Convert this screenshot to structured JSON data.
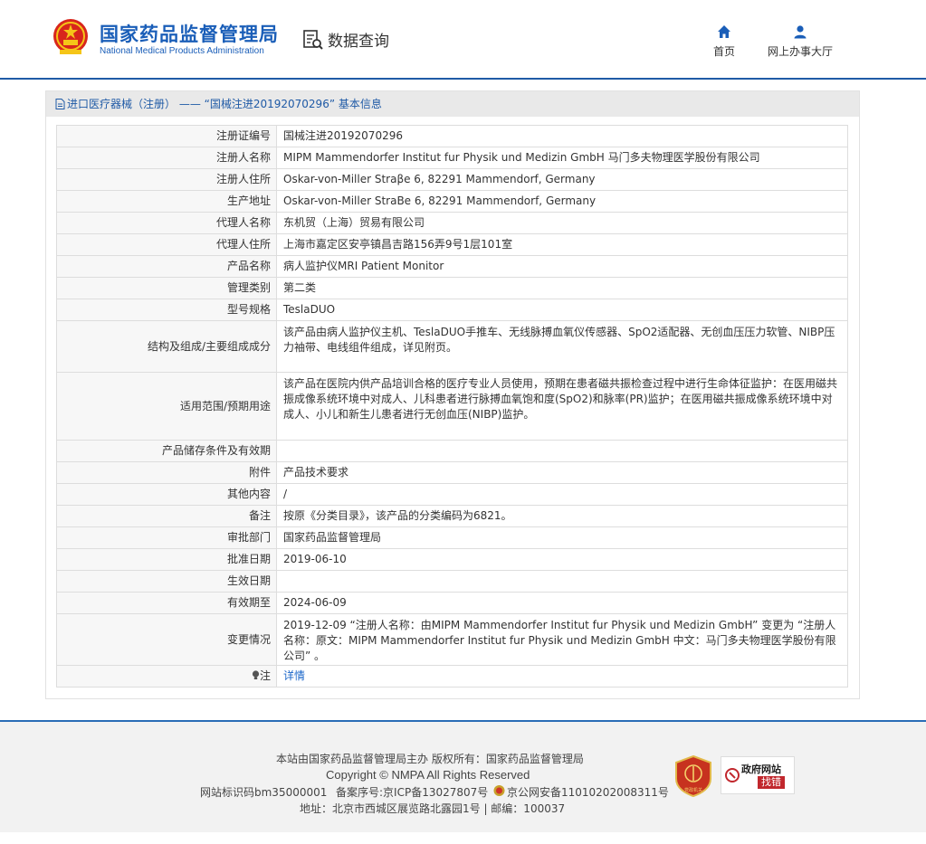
{
  "header": {
    "logo_cn": "国家药品监督管理局",
    "logo_en": "National Medical Products Administration",
    "query_label": "数据查询",
    "nav": [
      {
        "label": "首页",
        "icon": "home-icon"
      },
      {
        "label": "网上办事大厅",
        "icon": "user-icon"
      }
    ],
    "brand_color": "#1a5eb8"
  },
  "breadcrumb": {
    "text": "进口医疗器械（注册） —— “国械注进20192070296” 基本信息",
    "icon": "document-icon"
  },
  "record": {
    "rows": [
      {
        "key": "注册证编号",
        "value": "国械注进20192070296"
      },
      {
        "key": "注册人名称",
        "value": "MIPM Mammendorfer Institut fur Physik und Medizin GmbH 马门多夫物理医学股份有限公司"
      },
      {
        "key": "注册人住所",
        "value": "Oskar-von-Miller Straβe 6, 82291 Mammendorf, Germany"
      },
      {
        "key": "生产地址",
        "value": "Oskar-von-Miller StraBe 6, 82291 Mammendorf, Germany"
      },
      {
        "key": "代理人名称",
        "value": "东机贸（上海）贸易有限公司"
      },
      {
        "key": "代理人住所",
        "value": "上海市嘉定区安亭镇昌吉路156弄9号1层101室"
      },
      {
        "key": "产品名称",
        "value": "病人监护仪MRI Patient Monitor"
      },
      {
        "key": "管理类别",
        "value": "第二类"
      },
      {
        "key": "型号规格",
        "value": "TeslaDUO"
      },
      {
        "key": "结构及组成/主要组成成分",
        "value": "该产品由病人监护仪主机、TeslaDUO手推车、无线脉搏血氧仪传感器、SpO2适配器、无创血压压力软管、NIBP压力袖带、电线组件组成，详见附页。"
      },
      {
        "key": "适用范围/预期用途",
        "value": "该产品在医院内供产品培训合格的医疗专业人员使用，预期在患者磁共振检查过程中进行生命体征监护：在医用磁共振成像系统环境中对成人、儿科患者进行脉搏血氧饱和度(SpO2)和脉率(PR)监护；在医用磁共振成像系统环境中对成人、小儿和新生儿患者进行无创血压(NIBP)监护。"
      },
      {
        "key": "产品储存条件及有效期",
        "value": ""
      },
      {
        "key": "附件",
        "value": "产品技术要求"
      },
      {
        "key": "其他内容",
        "value": "/"
      },
      {
        "key": "备注",
        "value": "按原《分类目录》，该产品的分类编码为6821。"
      },
      {
        "key": "审批部门",
        "value": "国家药品监督管理局"
      },
      {
        "key": "批准日期",
        "value": "2019-06-10"
      },
      {
        "key": "生效日期",
        "value": ""
      },
      {
        "key": "有效期至",
        "value": "2024-06-09"
      },
      {
        "key": "变更情况",
        "value": "2019-12-09 “注册人名称：由MIPM Mammendorfer Institut fur Physik und Medizin GmbH” 变更为 “注册人名称：原文：MIPM Mammendorfer Institut fur Physik und Medizin GmbH 中文：马门多夫物理医学股份有限公司” 。"
      }
    ],
    "note_key": "注",
    "note_icon": "bulb-icon",
    "note_link": "详情"
  },
  "footer": {
    "line1": "本站由国家药品监督管理局主办 版权所有：国家药品监督管理局",
    "line2": "Copyright © NMPA All Rights Reserved",
    "site_id": "网站标识码bm35000001",
    "icp": "备案序号:京ICP备13027807号",
    "police": "京公网安备11010202008311号",
    "address": "地址：北京市西城区展览路北露园1号 | 邮编：100037",
    "badge1_text": "党政机关",
    "badge2_title": "政府网站",
    "badge2_sub": "找错"
  }
}
